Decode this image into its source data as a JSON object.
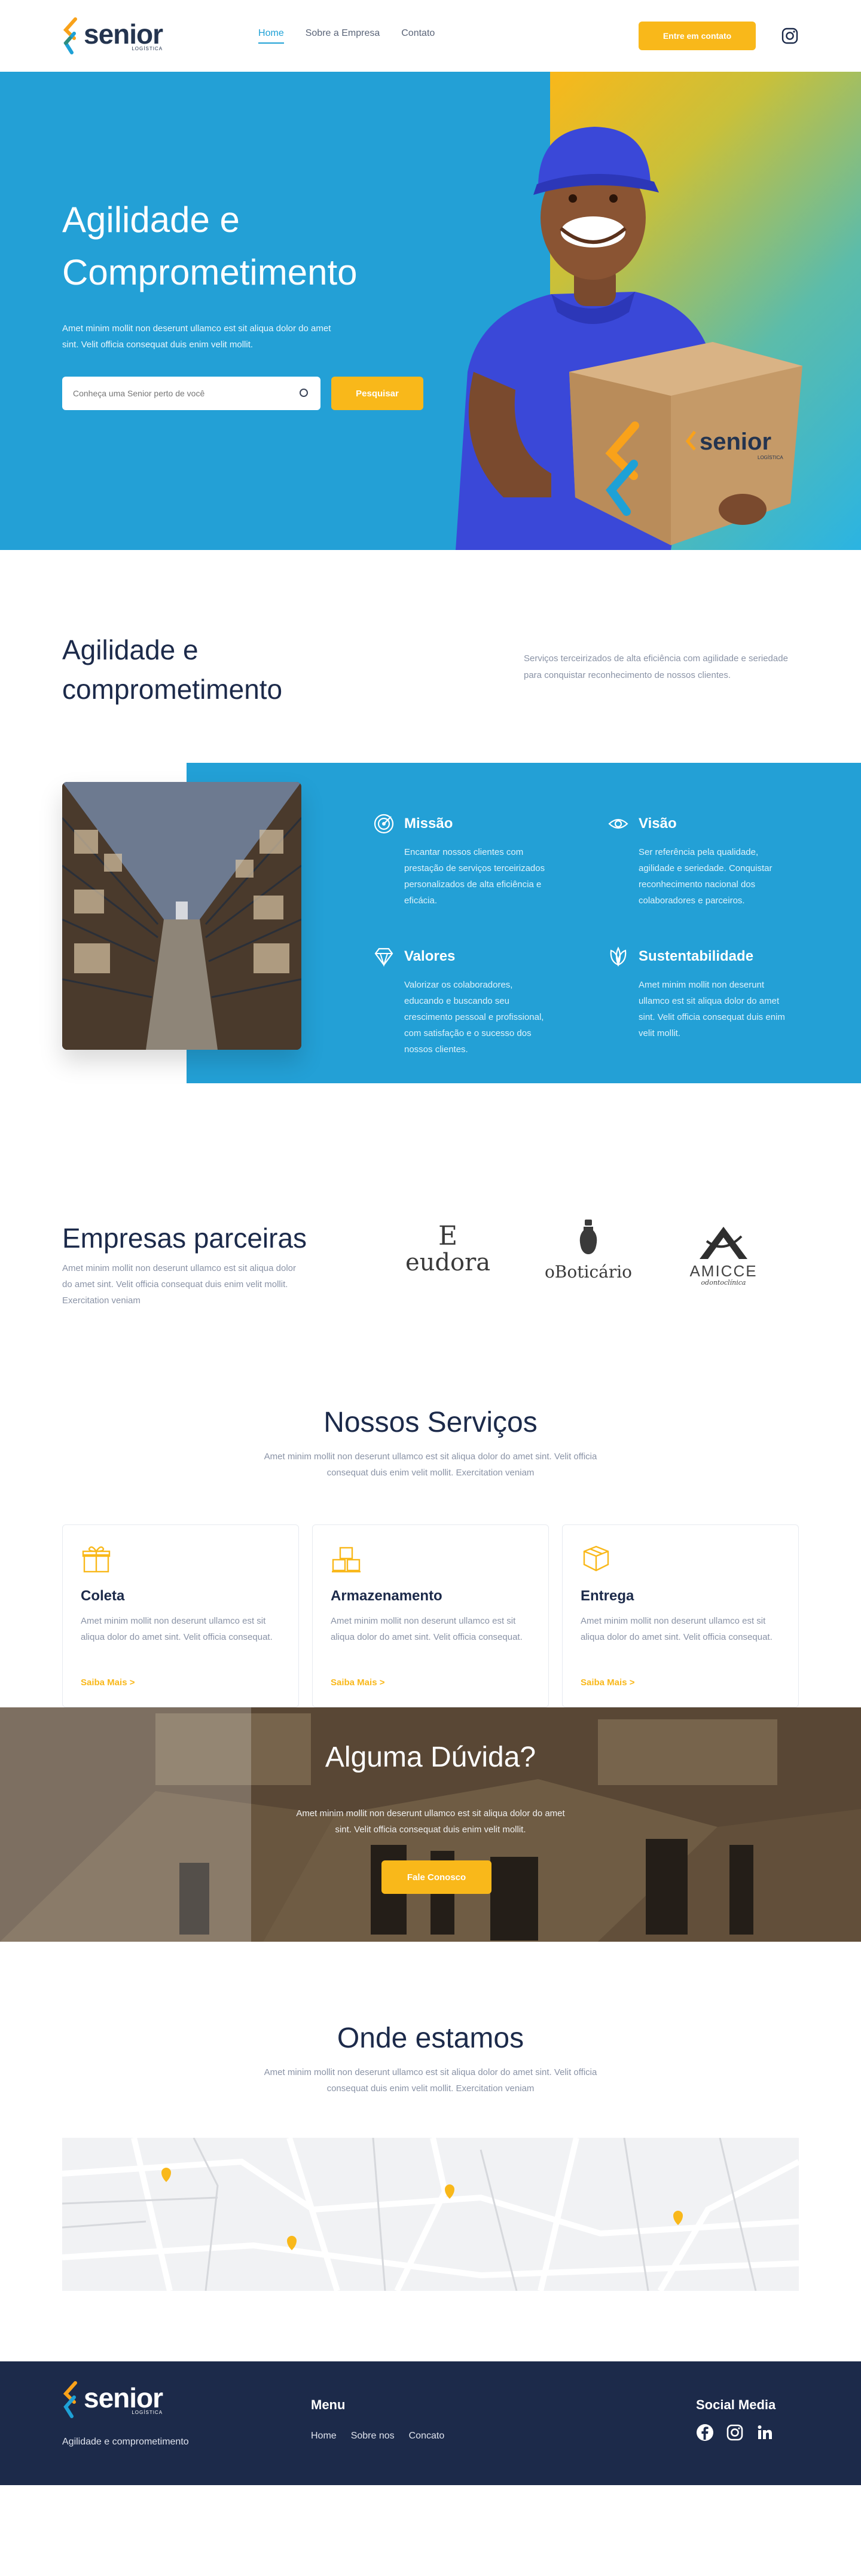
{
  "brand": {
    "name": "senior",
    "sub": "LOGÍSTICA",
    "colors": {
      "primary": "#23a0d6",
      "accent": "#f9b81a",
      "navy": "#1c2a4a"
    }
  },
  "nav": {
    "items": [
      "Home",
      "Sobre a Empresa",
      "Contato"
    ],
    "cta": "Entre em contato"
  },
  "hero": {
    "title": "Agilidade e Comprometimento",
    "description": "Amet minim mollit non deserunt ullamco est sit aliqua dolor do amet sint. Velit officia consequat duis enim velit mollit.",
    "search_placeholder": "Conheça uma Senior perto de você",
    "search_button": "Pesquisar",
    "box_brand": "senior",
    "box_sub": "LOGÍSTICA"
  },
  "about": {
    "title": "Agilidade e comprometimento",
    "description": "Serviços terceirizados de alta eficiência com agilidade e seriedade para conquistar reconhecimento de nossos clientes."
  },
  "values": [
    {
      "title": "Missão",
      "icon": "target-icon",
      "text": "Encantar nossos clientes com prestação de serviços terceirizados personalizados de alta eficiência e eficácia."
    },
    {
      "title": "Visão",
      "icon": "eye-icon",
      "text": "Ser referência pela qualidade, agilidade e seriedade. Conquistar reconhecimento nacional dos colaboradores e parceiros."
    },
    {
      "title": "Valores",
      "icon": "diamond-icon",
      "text": "Valorizar os colaboradores, educando e buscando seu crescimento pessoal e profissional, com satisfação e o sucesso dos nossos clientes."
    },
    {
      "title": "Sustentabilidade",
      "icon": "leaf-icon",
      "text": "Amet minim mollit non deserunt ullamco est sit aliqua dolor do amet sint. Velit officia consequat duis enim velit mollit."
    }
  ],
  "partners": {
    "title": "Empresas parceiras",
    "description": "Amet minim mollit non deserunt ullamco est sit aliqua dolor do amet sint. Velit officia consequat duis enim velit mollit. Exercitation veniam",
    "logos": [
      {
        "name": "eudora",
        "mark": "E"
      },
      {
        "name": "oBoticário"
      },
      {
        "name": "AMICCE",
        "sub": "odontoclínica"
      }
    ]
  },
  "services": {
    "title": "Nossos Serviços",
    "description": "Amet minim mollit non deserunt ullamco est sit aliqua dolor do amet sint. Velit officia consequat duis enim velit mollit. Exercitation veniam",
    "cards": [
      {
        "title": "Coleta",
        "icon": "gift-box-icon",
        "text": "Amet minim mollit non deserunt ullamco est sit aliqua dolor do amet sint. Velit officia consequat.",
        "link": "Saiba Mais >"
      },
      {
        "title": "Armazenamento",
        "icon": "storage-boxes-icon",
        "text": "Amet minim mollit non deserunt ullamco est sit aliqua dolor do amet sint. Velit officia consequat.",
        "link": "Saiba Mais >"
      },
      {
        "title": "Entrega",
        "icon": "delivery-box-icon",
        "text": "Amet minim mollit non deserunt ullamco est sit aliqua dolor do amet sint. Velit officia consequat.",
        "link": "Saiba Mais >"
      }
    ]
  },
  "doubts": {
    "title": "Alguma Dúvida?",
    "description": "Amet minim mollit non deserunt ullamco est sit aliqua dolor do amet sint. Velit officia consequat duis enim velit mollit.",
    "button": "Fale Conosco"
  },
  "location": {
    "title": "Onde estamos",
    "description": "Amet minim mollit non deserunt ullamco est sit aliqua dolor do amet sint. Velit officia consequat duis enim velit mollit. Exercitation veniam"
  },
  "footer": {
    "tagline": "Agilidade e comprometimento",
    "menu_title": "Menu",
    "menu": [
      "Home",
      "Sobre nos",
      "Concato"
    ],
    "social_title": "Social Media"
  }
}
